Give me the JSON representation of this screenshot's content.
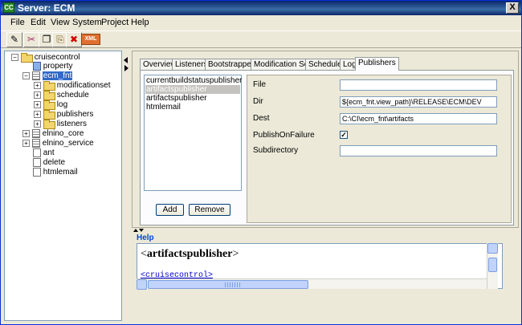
{
  "window": {
    "title": "Server: ECM",
    "app_icon": "CC",
    "close_label": "X"
  },
  "menu": [
    "File",
    "Edit",
    "View",
    "System",
    "Project",
    "Help"
  ],
  "toolbar": {
    "buttons": [
      {
        "name": "save-icon",
        "glyph": "✎"
      },
      {
        "name": "cut-icon",
        "glyph": "✂"
      },
      {
        "name": "copy-icon",
        "glyph": "❐"
      },
      {
        "name": "paste-icon",
        "glyph": "⎘"
      },
      {
        "name": "delete-icon",
        "glyph": "✖"
      }
    ],
    "xml_label": "XML"
  },
  "tree": {
    "root": "cruisecontrol",
    "nodes": [
      {
        "label": "cruisecontrol"
      },
      {
        "label": "property"
      },
      {
        "label": "ecm_fnt"
      },
      {
        "label": "modificationset"
      },
      {
        "label": "schedule"
      },
      {
        "label": "log"
      },
      {
        "label": "publishers"
      },
      {
        "label": "listeners"
      },
      {
        "label": "elnino_core"
      },
      {
        "label": "elnino_service"
      },
      {
        "label": "ant"
      },
      {
        "label": "delete"
      },
      {
        "label": "htmlemail"
      }
    ]
  },
  "tabs": [
    "Overview",
    "Listeners",
    "Bootstrappers",
    "Modification Sets",
    "Schedule",
    "Log",
    "Publishers"
  ],
  "active_tab": "Publishers",
  "publishers_list": [
    "currentbuildstatuspublisher",
    "artifactspublisher",
    "artifactspublisher",
    "htmlemail"
  ],
  "selected_publisher_index": 1,
  "buttons": {
    "add": "Add",
    "remove": "Remove"
  },
  "properties": {
    "file_label": "File",
    "file_value": "",
    "dir_label": "Dir",
    "dir_value": "${ecm_fnt.view_path}\\RELEASE\\ECM\\DEV",
    "dest_label": "Dest",
    "dest_value": "C:\\CI\\ecm_fnt\\artifacts",
    "publish_label": "PublishOnFailure",
    "publish_checked": "✓",
    "subdir_label": "Subdirectory",
    "subdir_value": ""
  },
  "help": {
    "label": "Help",
    "title_open": "<",
    "title_name": "artifactspublisher",
    "title_close": ">",
    "link": "<cruisecontrol>"
  }
}
